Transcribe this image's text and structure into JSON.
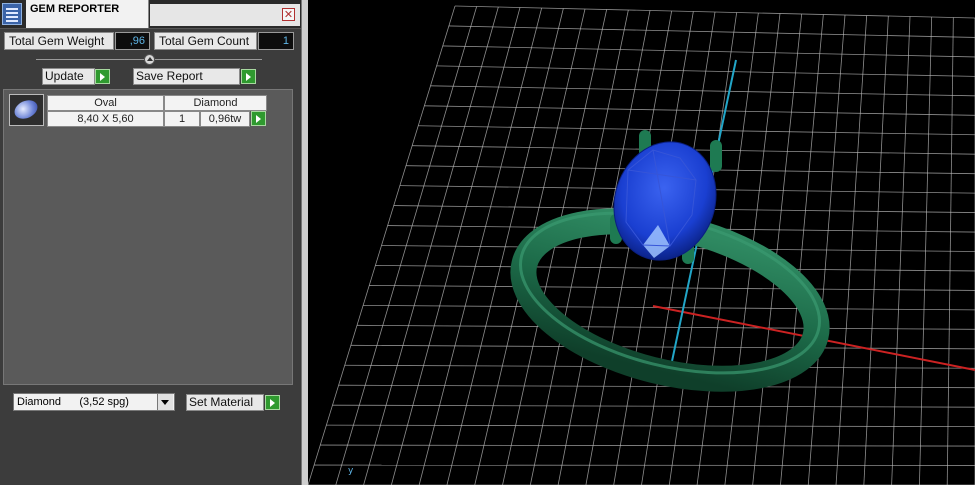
{
  "window": {
    "title": "GEM REPORTER",
    "close_symbol": "✕"
  },
  "totals": {
    "weight_label": "Total Gem Weight",
    "weight_value": ",96",
    "count_label": "Total Gem Count",
    "count_value": "1"
  },
  "buttons": {
    "update_label": "Update",
    "save_report_label": "Save Report",
    "set_material_label": "Set Material"
  },
  "gem_list": {
    "items": [
      {
        "shape": "Oval",
        "material": "Diamond",
        "size": "8,40 X 5,60",
        "count": "1",
        "weight": "0,96tw"
      }
    ]
  },
  "material_select": {
    "value": "Diamond      (3,52 spg)"
  },
  "viewport": {
    "axis_label": "y"
  },
  "colors": {
    "panel_bg": "#3c3c3c",
    "list_bg": "#5a5a5a",
    "value_text": "#5fb6e8",
    "arrow_button": "#2f9a2f",
    "grid": "#bdbdbd",
    "x_axis": "#cc2222",
    "y_axis": "#22a6c8",
    "ring": "#1e6b4a",
    "gem": "#1a3fd1"
  },
  "icons": [
    "gem-reporter-app-icon",
    "close-icon",
    "slider-knob-icon",
    "play-arrow-icon",
    "oval-gem-thumbnail-icon",
    "dropdown-arrow-icon"
  ]
}
